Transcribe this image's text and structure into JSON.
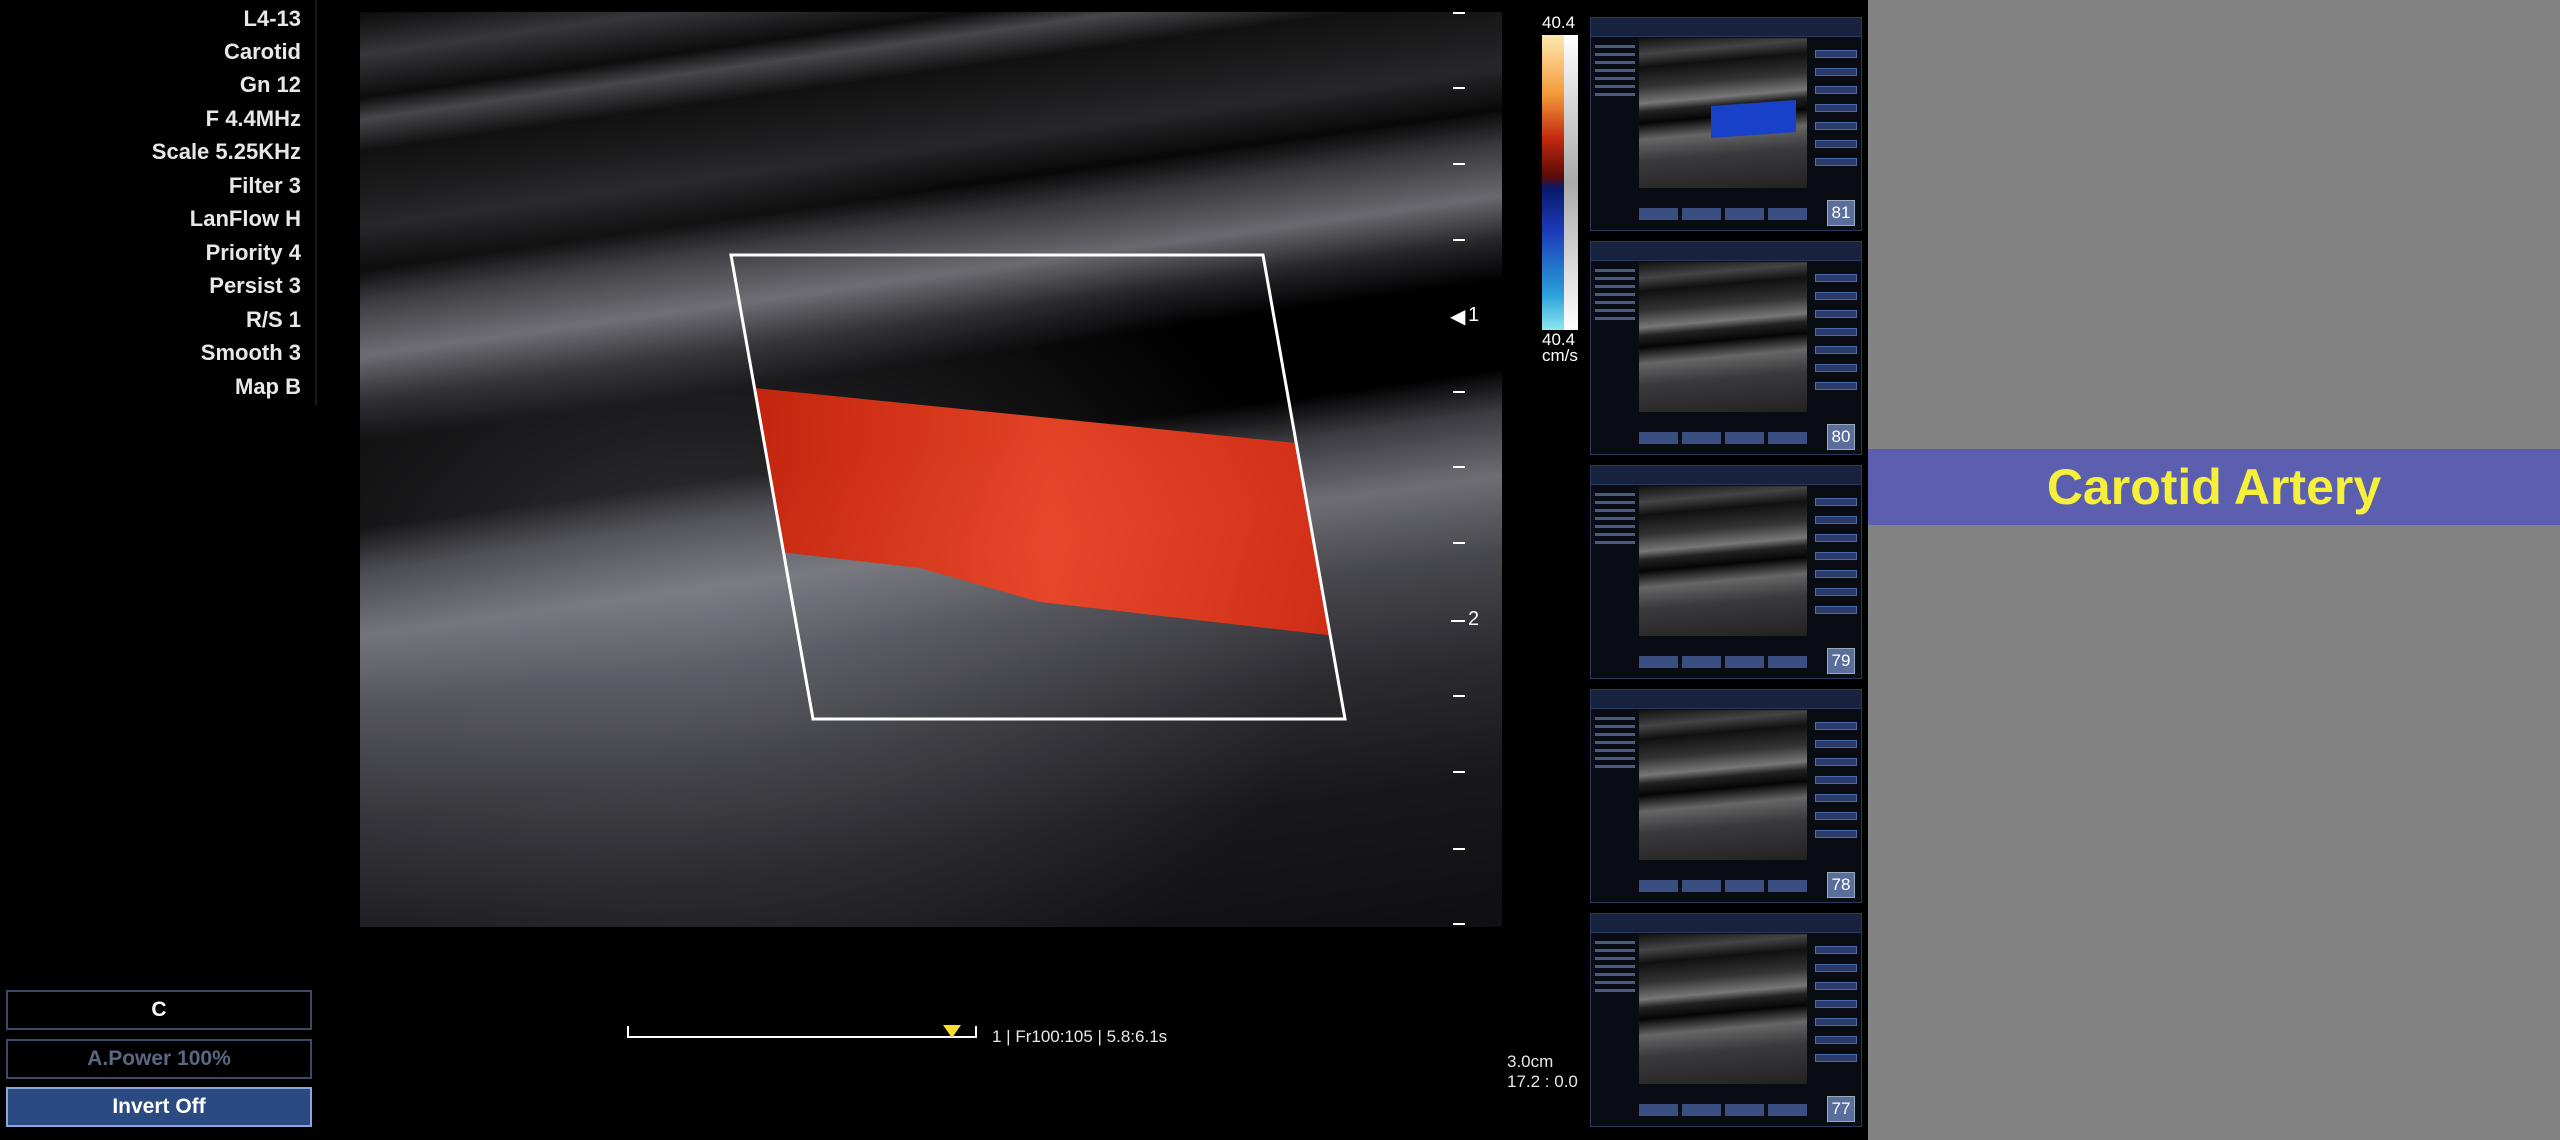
{
  "parameters": [
    "L4-13",
    "Carotid",
    "Gn 12",
    "F 4.4MHz",
    "Scale 5.25KHz",
    "Filter 3",
    "LanFlow H",
    "Priority 4",
    "Persist 3",
    "R/S 1",
    "Smooth 3",
    "Map B"
  ],
  "controls": {
    "mode": "C",
    "power": "A.Power 100%",
    "invert": "Invert  Off"
  },
  "color_scale": {
    "top": "40.4",
    "bottom": "40.4",
    "unit": "cm/s"
  },
  "depth_markers": {
    "one": "1",
    "two": "2"
  },
  "frame_info": "1 | Fr100:105 | 5.8:6.1s",
  "scale_info": {
    "depth": "3.0cm",
    "ratio": "17.2 : 0.0"
  },
  "thumbnails": [
    "81",
    "80",
    "79",
    "78",
    "77"
  ],
  "banner": "Carotid Artery",
  "colors": {
    "flow": "#d8321a",
    "banner_bg": "#5c5fb0",
    "banner_text": "#f6f03a",
    "panel_bg": "#828282"
  }
}
